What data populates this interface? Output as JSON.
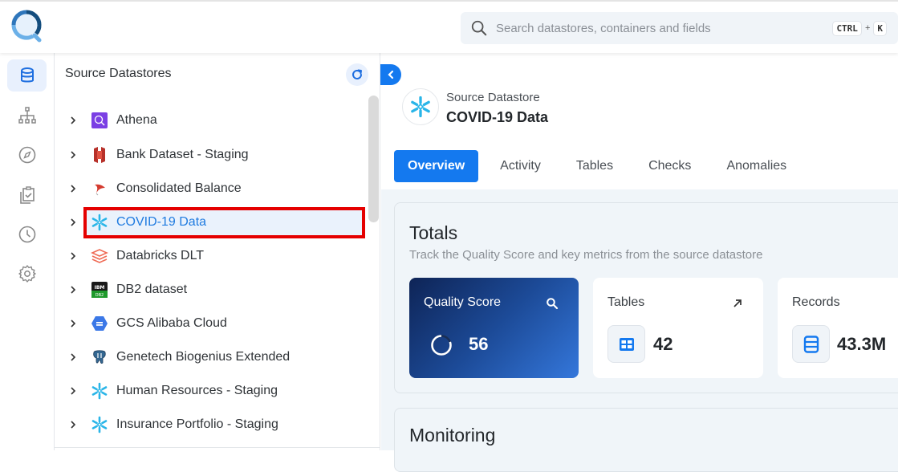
{
  "search": {
    "placeholder": "Search datastores, containers and fields",
    "shortcut_key1": "CTRL",
    "shortcut_plus": "+",
    "shortcut_key2": "K"
  },
  "rail": {
    "items": [
      {
        "icon": "database-icon",
        "active": true
      },
      {
        "icon": "hierarchy-icon",
        "active": false
      },
      {
        "icon": "compass-icon",
        "active": false
      },
      {
        "icon": "clipboard-check-icon",
        "active": false
      },
      {
        "icon": "clock-icon",
        "active": false
      },
      {
        "icon": "gear-icon",
        "active": false
      }
    ]
  },
  "panel": {
    "title": "Source Datastores",
    "items": [
      {
        "label": "Athena",
        "icon": "athena-icon"
      },
      {
        "label": "Bank Dataset - Staging",
        "icon": "s3-icon"
      },
      {
        "label": "Consolidated Balance",
        "icon": "sqlserver-icon"
      },
      {
        "label": "COVID-19 Data",
        "icon": "snowflake-icon",
        "selected": true
      },
      {
        "label": "Databricks DLT",
        "icon": "databricks-icon"
      },
      {
        "label": "DB2 dataset",
        "icon": "db2-icon"
      },
      {
        "label": "GCS Alibaba Cloud",
        "icon": "gcs-icon"
      },
      {
        "label": "Genetech Biogenius Extended",
        "icon": "postgresql-icon"
      },
      {
        "label": "Human Resources - Staging",
        "icon": "snowflake-icon"
      },
      {
        "label": "Insurance Portfolio - Staging",
        "icon": "snowflake-icon"
      }
    ]
  },
  "header": {
    "subtitle": "Source Datastore",
    "title": "COVID-19 Data"
  },
  "tabs": [
    {
      "label": "Overview",
      "active": true
    },
    {
      "label": "Activity",
      "active": false
    },
    {
      "label": "Tables",
      "active": false
    },
    {
      "label": "Checks",
      "active": false
    },
    {
      "label": "Anomalies",
      "active": false
    }
  ],
  "totals": {
    "title": "Totals",
    "subtitle": "Track the Quality Score and key metrics from the source datastore",
    "quality_score": {
      "label": "Quality Score",
      "value": "56",
      "progress": 0.56
    },
    "tables": {
      "label": "Tables",
      "value": "42"
    },
    "records": {
      "label": "Records",
      "value": "43.3M"
    }
  },
  "monitoring": {
    "title": "Monitoring"
  },
  "colors": {
    "accent": "#1479ef",
    "selection_border": "#e50000",
    "selection_bg": "#eaf2fc",
    "content_bg": "#f0f5f9"
  }
}
